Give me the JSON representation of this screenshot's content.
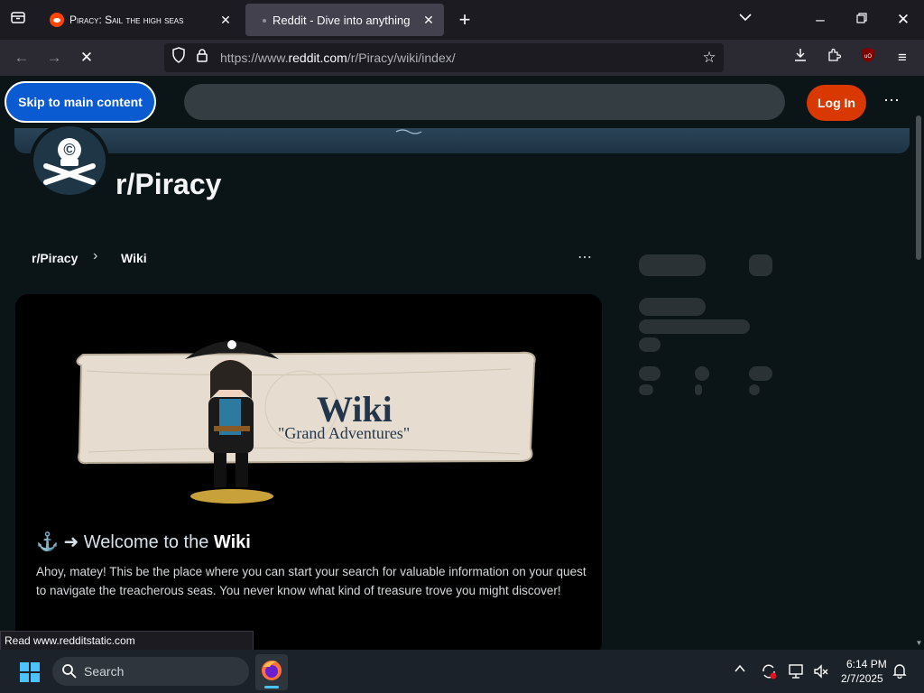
{
  "browser": {
    "tabs": [
      {
        "title": "Piracy: Sail the high seas",
        "active": false
      },
      {
        "title": "Reddit - Dive into anything",
        "active": true
      }
    ],
    "url_prefix": "https://www.",
    "url_domain": "reddit.com",
    "url_path": "/r/Piracy/wiki/index/",
    "status_text": "Read www.redditstatic.com"
  },
  "reddit": {
    "skip_label": "Skip to main content",
    "login_label": "Log In",
    "subreddit": "r/Piracy",
    "breadcrumb": [
      "r/Piracy",
      "Wiki"
    ]
  },
  "wiki": {
    "scroll_title": "Wiki",
    "scroll_subtitle": "\"Grand Adventures\"",
    "heading_prefix": "⚓ ➜ Welcome to the ",
    "heading_bold": "Wiki",
    "paragraph": "Ahoy, matey! This be the place where you can start your search for valuable information on your quest to navigate the treacherous seas. You never know what kind of treasure trove you might discover!"
  },
  "taskbar": {
    "search_label": "Search",
    "time": "6:14 PM",
    "date": "2/7/2025"
  },
  "colors": {
    "reddit_orange": "#d93900",
    "skip_blue": "#0a5ad1",
    "page_bg": "#0b1416"
  }
}
